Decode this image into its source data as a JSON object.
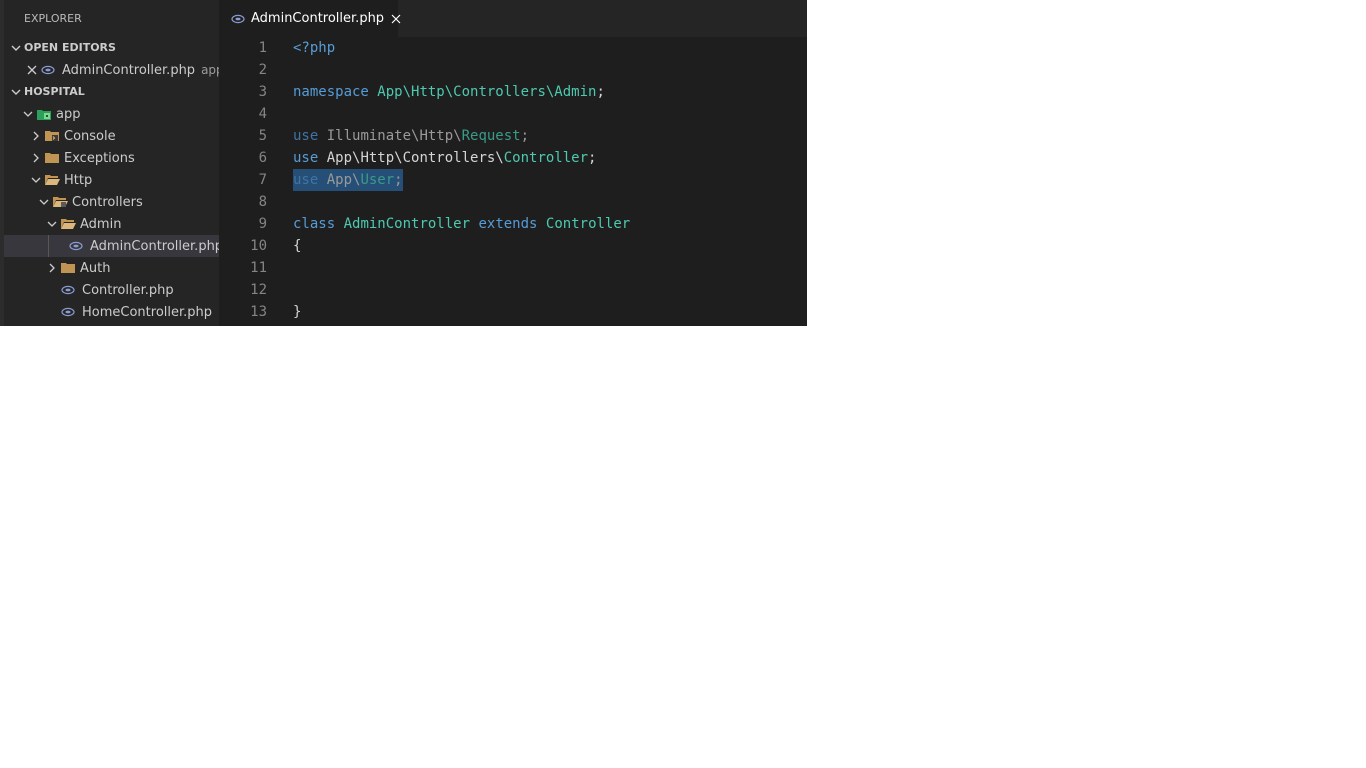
{
  "colors": {
    "sidebar_bg": "#252526",
    "editor_bg": "#1e1e1e",
    "keyword": "#569cd6",
    "type": "#4ec9b0",
    "selection": "#264f78",
    "line_number": "#858585"
  },
  "sidebar": {
    "title": "EXPLORER",
    "open_editors": {
      "header": "OPEN EDITORS",
      "items": [
        {
          "name": "AdminController.php",
          "description": "app...",
          "icon": "php-elephant-icon"
        }
      ]
    },
    "project": {
      "header": "HOSPITAL",
      "tree": [
        {
          "label": "app",
          "icon": "app-folder-icon",
          "expanded": true
        },
        {
          "label": "Console",
          "icon": "console-folder-icon",
          "expanded": false
        },
        {
          "label": "Exceptions",
          "icon": "folder-icon",
          "expanded": false
        },
        {
          "label": "Http",
          "icon": "folder-open-icon",
          "expanded": true
        },
        {
          "label": "Controllers",
          "icon": "controllers-folder-icon",
          "expanded": true
        },
        {
          "label": "Admin",
          "icon": "folder-open-icon",
          "expanded": true
        },
        {
          "label": "AdminController.php",
          "icon": "php-elephant-icon",
          "selected": true
        },
        {
          "label": "Auth",
          "icon": "folder-icon",
          "expanded": false
        },
        {
          "label": "Controller.php",
          "icon": "php-elephant-icon"
        },
        {
          "label": "HomeController.php",
          "icon": "php-elephant-icon"
        }
      ]
    }
  },
  "tabs": [
    {
      "label": "AdminController.php",
      "icon": "php-elephant-icon",
      "active": true
    }
  ],
  "editor": {
    "lines": [
      {
        "number": "1",
        "tokens": [
          {
            "text": "<?php",
            "kind": "kw"
          }
        ]
      },
      {
        "number": "2",
        "tokens": []
      },
      {
        "number": "3",
        "tokens": [
          {
            "text": "namespace",
            "kind": "kw"
          },
          {
            "text": " ",
            "kind": "plain"
          },
          {
            "text": "App\\Http\\Controllers\\Admin",
            "kind": "ns"
          },
          {
            "text": ";",
            "kind": "plain"
          }
        ]
      },
      {
        "number": "4",
        "tokens": []
      },
      {
        "number": "5",
        "tokens": [
          {
            "text": "use",
            "kind": "dimkw"
          },
          {
            "text": " Illuminate\\Http\\",
            "kind": "dim"
          },
          {
            "text": "Request",
            "kind": "dimns"
          },
          {
            "text": ";",
            "kind": "dim"
          }
        ]
      },
      {
        "number": "6",
        "tokens": [
          {
            "text": "use",
            "kind": "kw"
          },
          {
            "text": " App\\Http\\Controllers\\",
            "kind": "plain"
          },
          {
            "text": "Controller",
            "kind": "ns"
          },
          {
            "text": ";",
            "kind": "plain"
          }
        ]
      },
      {
        "number": "7",
        "selected": true,
        "tokens": [
          {
            "text": "use",
            "kind": "dimkw"
          },
          {
            "text": " App\\",
            "kind": "dim"
          },
          {
            "text": "User",
            "kind": "dimns"
          },
          {
            "text": ";",
            "kind": "dim"
          }
        ]
      },
      {
        "number": "8",
        "tokens": []
      },
      {
        "number": "9",
        "tokens": [
          {
            "text": "class",
            "kind": "kw"
          },
          {
            "text": " ",
            "kind": "plain"
          },
          {
            "text": "AdminController",
            "kind": "ns"
          },
          {
            "text": " ",
            "kind": "plain"
          },
          {
            "text": "extends",
            "kind": "kw"
          },
          {
            "text": " ",
            "kind": "plain"
          },
          {
            "text": "Controller",
            "kind": "ns"
          }
        ]
      },
      {
        "number": "10",
        "tokens": [
          {
            "text": "{",
            "kind": "plain"
          }
        ]
      },
      {
        "number": "11",
        "tokens": []
      },
      {
        "number": "12",
        "tokens": []
      },
      {
        "number": "13",
        "tokens": [
          {
            "text": "}",
            "kind": "plain"
          }
        ]
      }
    ]
  }
}
